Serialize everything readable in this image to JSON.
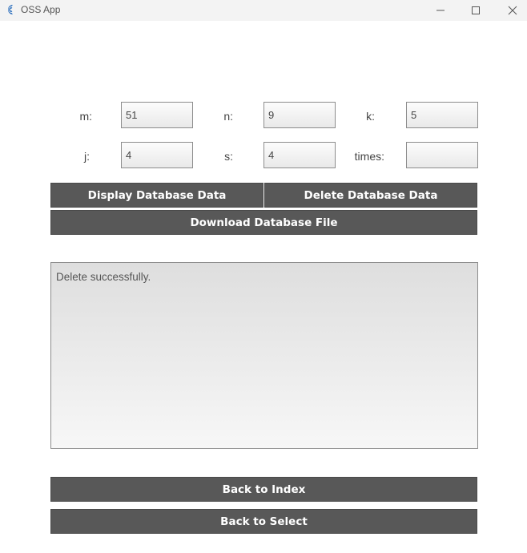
{
  "window": {
    "title": "OSS App",
    "icon": "app-logo-icon",
    "controls": [
      "minimize-icon",
      "maximize-icon",
      "close-icon"
    ]
  },
  "params": {
    "m": {
      "label": "m:",
      "value": "51"
    },
    "n": {
      "label": "n:",
      "value": "9"
    },
    "k": {
      "label": "k:",
      "value": "5"
    },
    "j": {
      "label": "j:",
      "value": "4"
    },
    "s": {
      "label": "s:",
      "value": "4"
    },
    "times": {
      "label": "times:",
      "value": ""
    }
  },
  "buttons": {
    "display": "Display Database Data",
    "delete": "Delete Database Data",
    "download": "Download Database File",
    "back_index": "Back to Index",
    "back_select": "Back to Select"
  },
  "output": {
    "text": "Delete successfully."
  },
  "colors": {
    "button_bg": "#585858",
    "button_text": "#ffffff",
    "titlebar_bg": "#f3f3f3"
  }
}
